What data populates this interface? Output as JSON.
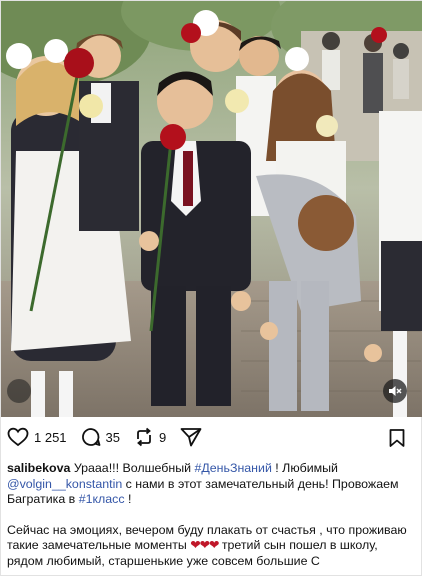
{
  "post": {
    "likes": "1 251",
    "comments": "35",
    "reposts": "9"
  },
  "caption": {
    "username": "salibekova",
    "line1_a": " Урааа!!! Волшебный ",
    "hashtag1": "#ДеньЗнаний",
    "line1_b": " ! Любимый",
    "mention": "@volgin__konstantin",
    "line2": " с нами в этот замечательный день! Провожаем Багратика в ",
    "hashtag2": "#1класс",
    "line2_end": " !",
    "para2_a": "Сейчас на эмоциях, вечером буду плакать от счастья , что проживаю такие замечательные моменты ",
    "hearts": "❤❤❤",
    "para2_b": " третий сын пошел в школу, рядом любимый, старшенькие уже совсем большие С"
  },
  "icons": {
    "like": "heart-outline-icon",
    "comment": "comment-bubble-icon",
    "repost": "repost-arrows-icon",
    "share": "send-paper-plane-icon",
    "save": "bookmark-icon",
    "mute": "speaker-muted-icon"
  },
  "colors": {
    "link": "#3557a8",
    "heart": "#c0182a",
    "text": "#111111"
  }
}
